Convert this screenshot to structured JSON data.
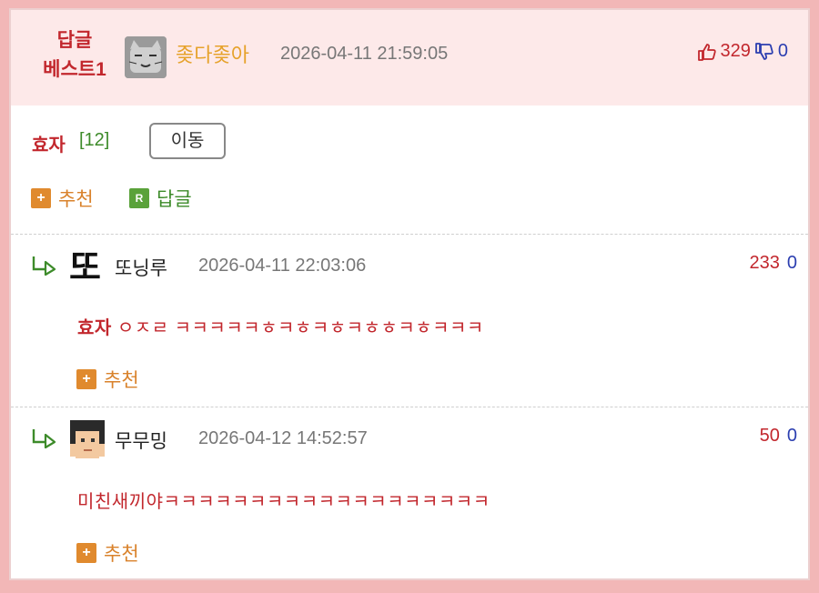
{
  "best": {
    "label_line1": "답글",
    "label_line2": "베스트1",
    "nickname": "좆다좆아",
    "datetime": "2026-04-11 21:59:05",
    "upvotes": "329",
    "downvotes": "0",
    "avatar_icon": "cat-face-icon",
    "main_nick": "효자",
    "main_reply_count": "[12]",
    "move_button": "이동",
    "recommend_label": "추천",
    "reply_label": "답글",
    "recommend_icon_glyph": "+",
    "reply_icon_glyph": "R"
  },
  "replies": [
    {
      "nickname": "또닝루",
      "datetime": "2026-04-11 22:03:06",
      "upvotes": "233",
      "downvotes": "0",
      "text_prefix": "효자",
      "text": " ㅇㅈㄹ ㅋㅋㅋㅋㅋㅎㅋㅎㅋㅎㅋㅎㅎㅋㅎㅋㅋㅋ",
      "recommend_label": "추천",
      "avatar_icon": "tto-text-avatar",
      "avatar_glyph": "또"
    },
    {
      "nickname": "무무밍",
      "datetime": "2026-04-12 14:52:57",
      "upvotes": "50",
      "downvotes": "0",
      "text": "미친새끼야ㅋㅋㅋㅋㅋㅋㅋㅋㅋㅋㅋㅋㅋㅋㅋㅋㅋㅋㅋ",
      "recommend_label": "추천",
      "avatar_icon": "pixel-face-avatar"
    }
  ],
  "colors": {
    "frame": "#f2b7b7",
    "header_bg": "#fde9e9",
    "accent_red": "#c2272d",
    "accent_green": "#3d8b2a",
    "accent_orange": "#e08a2e",
    "down_blue": "#2b3eb0"
  }
}
